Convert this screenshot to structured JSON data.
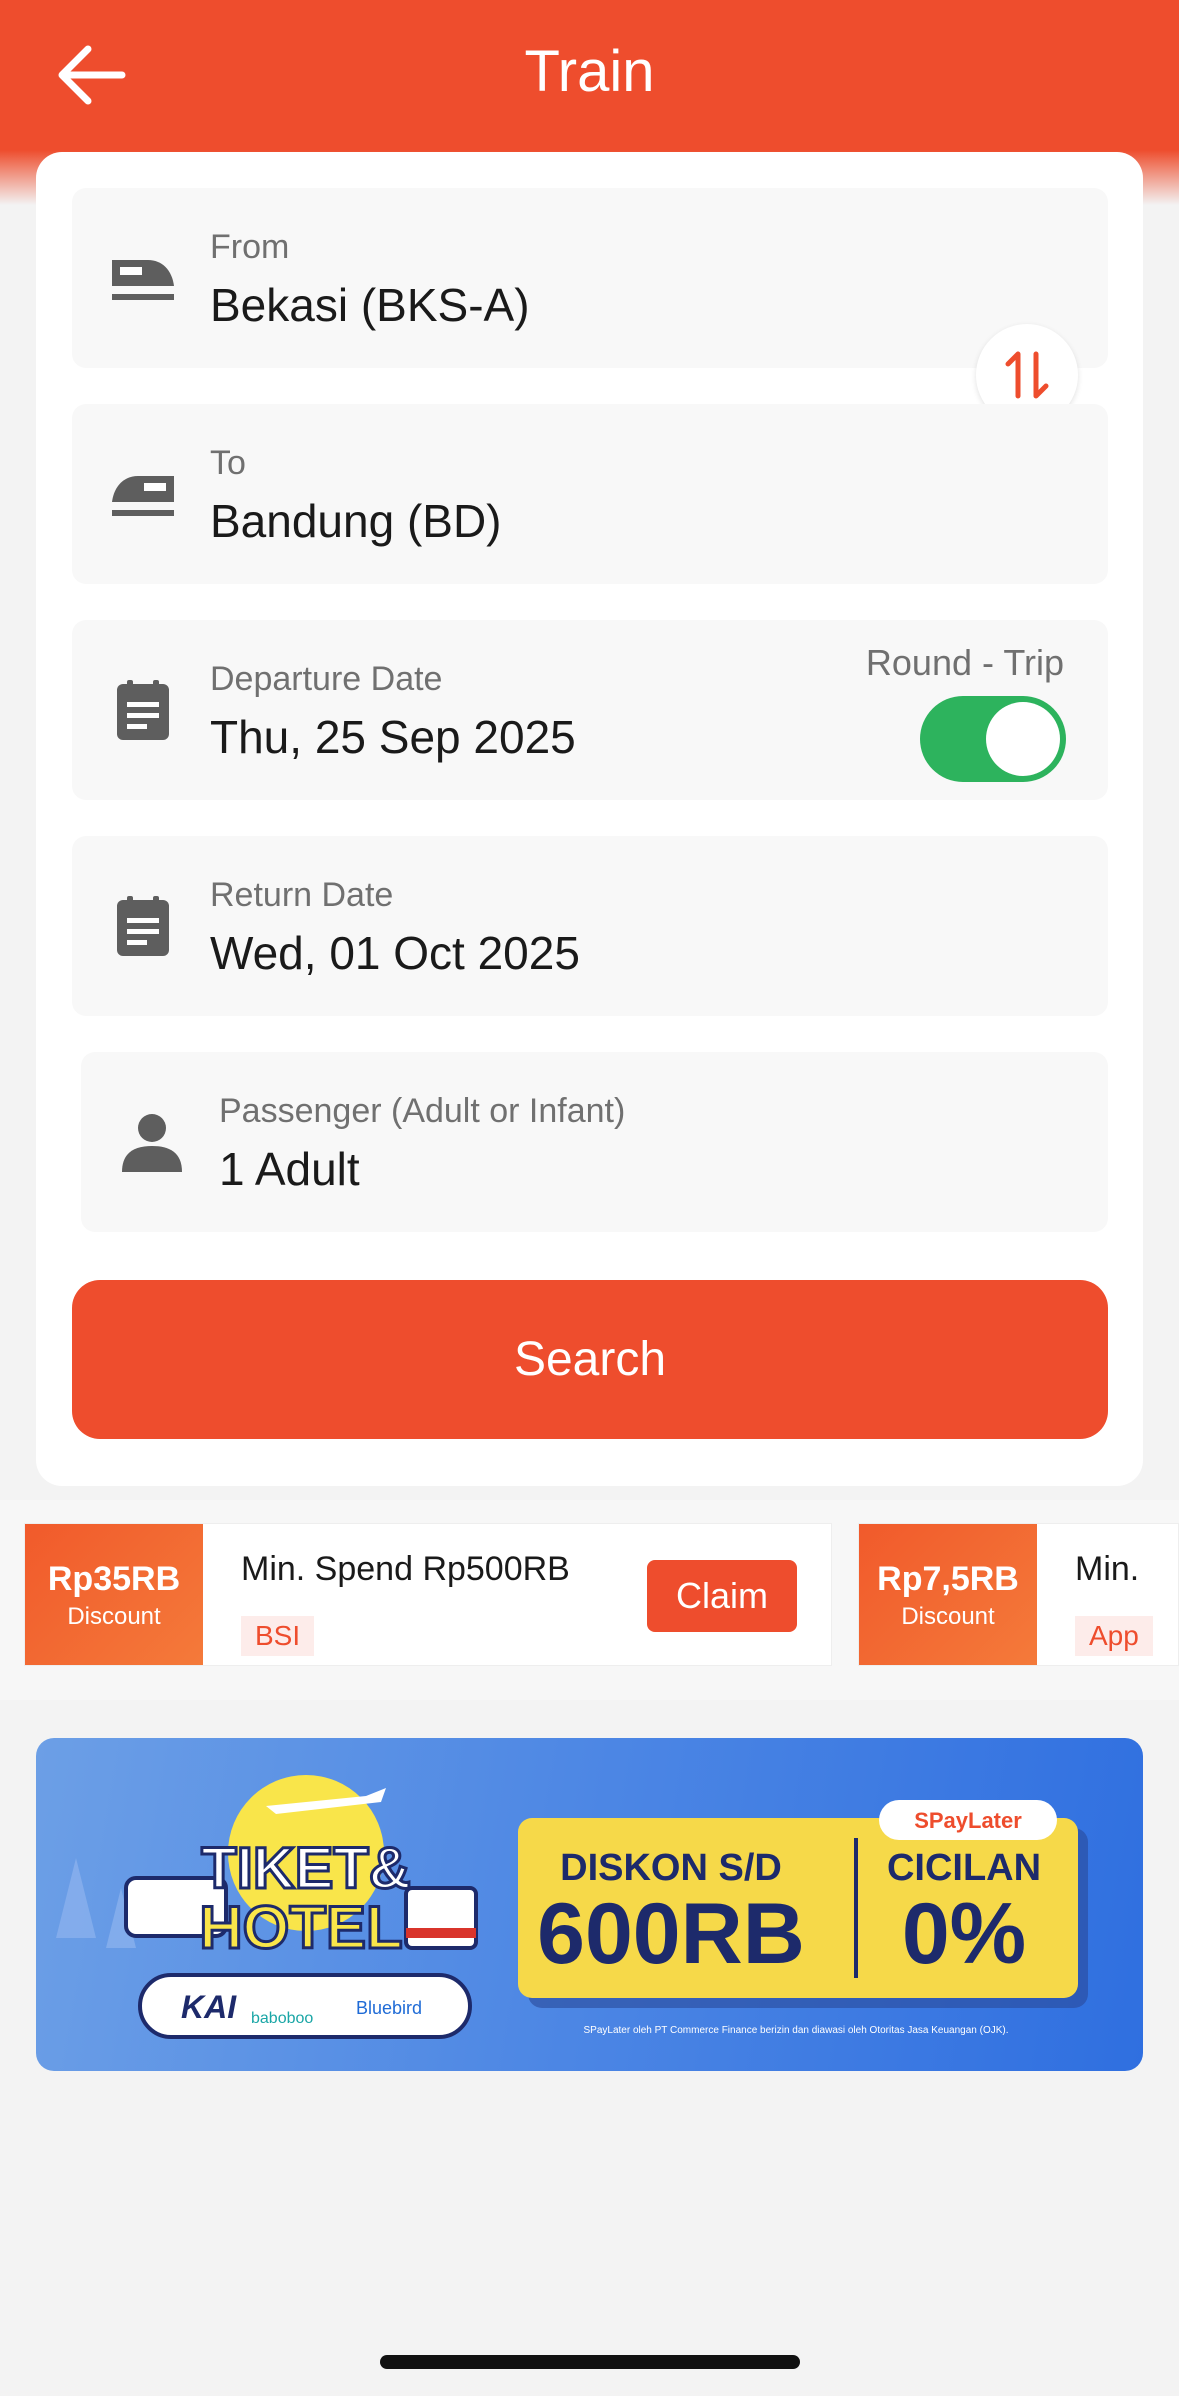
{
  "header": {
    "title": "Train",
    "accent": "#ee4d2d"
  },
  "form": {
    "from": {
      "label": "From",
      "value": "Bekasi (BKS-A)"
    },
    "to": {
      "label": "To",
      "value": "Bandung (BD)"
    },
    "departure": {
      "label": "Departure Date",
      "value": "Thu, 25 Sep 2025"
    },
    "round_trip": {
      "label": "Round - Trip",
      "enabled": true
    },
    "return": {
      "label": "Return Date",
      "value": "Wed, 01 Oct 2025"
    },
    "passenger": {
      "label": "Passenger (Adult or Infant)",
      "value": "1 Adult"
    },
    "search_label": "Search"
  },
  "vouchers": [
    {
      "amount": "Rp35RB",
      "sub": "Discount",
      "text": "Min. Spend Rp500RB",
      "tag": "BSI",
      "claim": "Claim"
    },
    {
      "amount": "Rp7,5RB",
      "sub": "Discount",
      "text": "Min.",
      "tag": "App"
    }
  ],
  "banner": {
    "brand1": "TIKET&",
    "brand2": "HOTEL",
    "partners": [
      "KAI",
      "baboboo",
      "Bluebird"
    ],
    "paylater": "SPayLater",
    "diskon_label": "DISKON S/D",
    "diskon_value": "600RB",
    "cicilan_label": "CICILAN",
    "cicilan_value": "0%",
    "disclaimer": "SPayLater oleh PT Commerce Finance berizin dan diawasi oleh Otoritas Jasa Keuangan (OJK)."
  }
}
